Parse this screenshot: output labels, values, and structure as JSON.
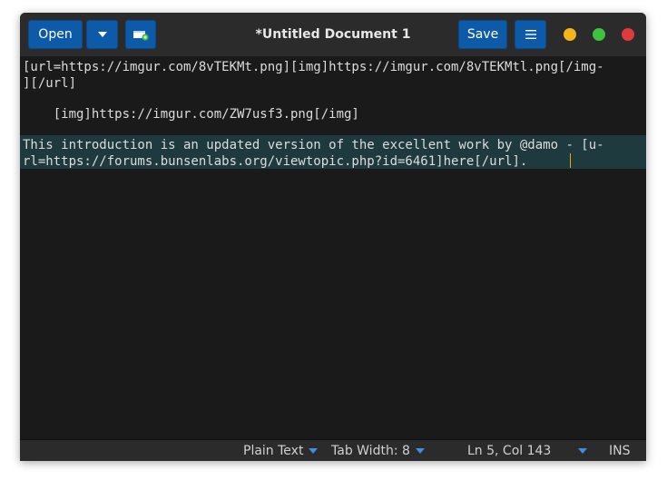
{
  "header": {
    "open_label": "Open",
    "title": "*Untitled Document 1",
    "save_label": "Save"
  },
  "editor": {
    "lines": [
      "[url=https://imgur.com/8vTEKMt.png][img]https://imgur.com/8vTEKMtl.png[/img-",
      "][/url]",
      "",
      "    [img]https://imgur.com/ZW7usf3.png[/img]",
      "",
      "This introduction is an updated version of the excellent work by @damo - [u-",
      "rl=https://forums.bunsenlabs.org/viewtopic.php?id=6461]here[/url]."
    ]
  },
  "status": {
    "language": "Plain Text",
    "tab_width": "Tab Width: 8",
    "position": "Ln 5, Col 143",
    "mode": "INS"
  },
  "colors": {
    "accent": "#0d5ba8",
    "current_line": "#1f3a3e",
    "caret": "#f0a500"
  }
}
